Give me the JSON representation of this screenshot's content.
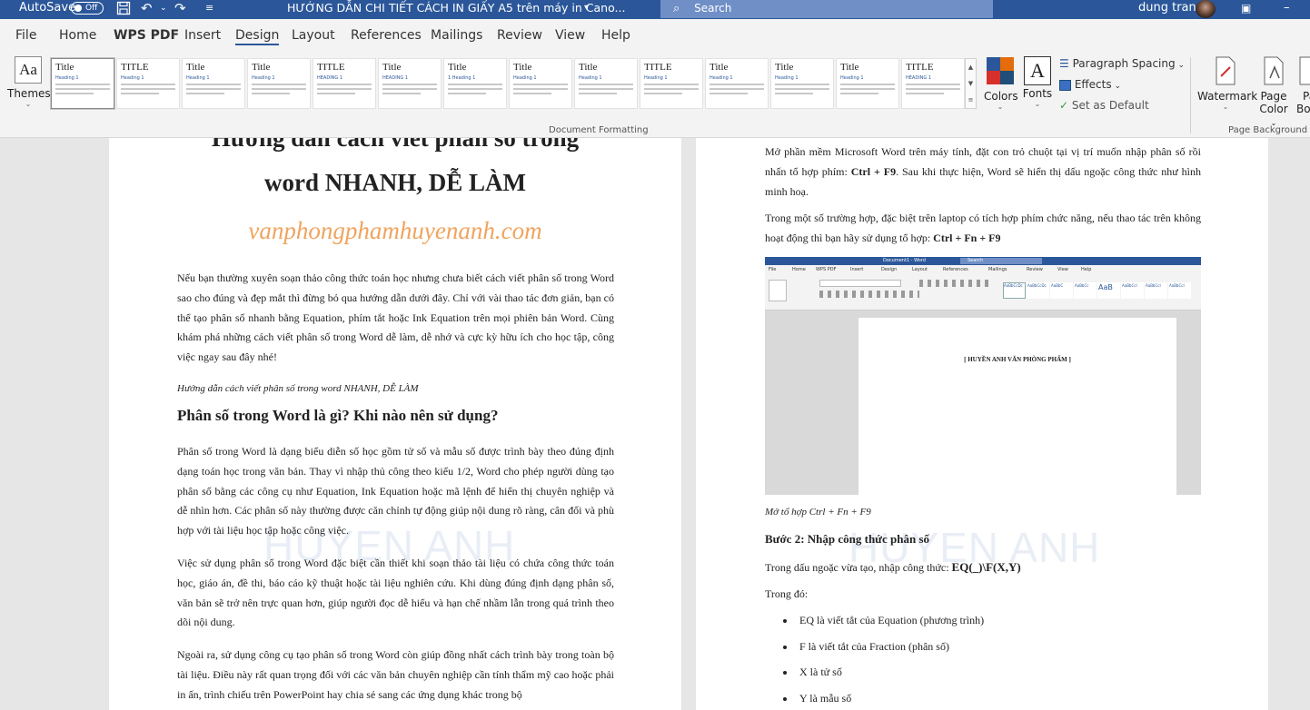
{
  "titlebar": {
    "autosave": "AutoSave",
    "autosave_state": "Off",
    "doc_title": "HƯỚNG DẪN CHI TIẾT CÁCH IN GIẤY A5 trên máy in Cano...",
    "search_placeholder": "Search",
    "user": "dung tran"
  },
  "menu": {
    "tabs": [
      "File",
      "Home",
      "WPS PDF",
      "Insert",
      "Design",
      "Layout",
      "References",
      "Mailings",
      "Review",
      "View",
      "Help"
    ],
    "active": "Design"
  },
  "ribbon": {
    "themes_label": "Themes",
    "themes_icon_text": "Aa",
    "styles": [
      {
        "title": "Title",
        "heading": "Heading 1"
      },
      {
        "title": "TITLE",
        "heading": "Heading 1"
      },
      {
        "title": "Title",
        "heading": "Heading 1"
      },
      {
        "title": "Title",
        "heading": "Heading 1"
      },
      {
        "title": "TITLE",
        "heading": "HEADING 1"
      },
      {
        "title": "Title",
        "heading": "HEADING 1"
      },
      {
        "title": "Title",
        "heading": "1 Heading 1"
      },
      {
        "title": "Title",
        "heading": "Heading 1"
      },
      {
        "title": "Title",
        "heading": "Heading 1"
      },
      {
        "title": "TITLE",
        "heading": "Heading 1"
      },
      {
        "title": "Title",
        "heading": "Heading 1"
      },
      {
        "title": "Title",
        "heading": "Heading 1"
      },
      {
        "title": "Title",
        "heading": "Heading 1"
      },
      {
        "title": "TITLE",
        "heading": "HEADING 1"
      }
    ],
    "group_document_formatting": "Document Formatting",
    "colors_label": "Colors",
    "fonts_label": "Fonts",
    "fonts_icon_text": "A",
    "paragraph_spacing": "Paragraph Spacing",
    "effects": "Effects",
    "set_default": "Set as Default",
    "watermark": "Watermark",
    "page_color_1": "Page",
    "page_color_2": "Color",
    "page_borders_1": "Pa",
    "page_borders_2": "Bo",
    "group_page_background": "Page Background"
  },
  "page1": {
    "title_line1": "Hướng dẫn cách viết phân số trong",
    "title_line2": "word NHANH, DỄ LÀM",
    "site": "vanphongphamhuyenanh.com",
    "p1": "Nếu bạn thường xuyên soạn thảo công thức toán học nhưng chưa biết cách viết phân số trong Word sao cho đúng và đẹp mắt thì đừng bỏ qua hướng dẫn dưới đây. Chỉ với vài thao tác đơn giản, bạn có thể tạo phân số nhanh bằng Equation, phím tắt hoặc Ink Equation trên mọi phiên bản Word. Cùng khám phá những cách viết phân số trong Word dễ làm, dễ nhớ và cực kỳ hữu ích cho học tập, công việc ngay sau đây nhé!",
    "caption": "Hướng dẫn cách viết phân số trong word NHANH, DỄ LÀM",
    "heading": "Phân số trong Word là gì? Khi nào nên sử dụng?",
    "p2": "Phân số trong Word là dạng biểu diễn số học gồm tử số và mẫu số được trình bày theo đúng định dạng toán học trong văn bản. Thay vì nhập thủ công theo kiểu 1/2, Word cho phép người dùng tạo phân số bằng các công cụ như Equation, Ink Equation hoặc mã lệnh để hiển thị chuyên nghiệp và dễ nhìn hơn. Các phân số này thường được căn chỉnh tự động giúp nội dung rõ ràng, cân đối và phù hợp với tài liệu học tập hoặc công việc.",
    "p3": "Việc sử dụng phân số trong Word đặc biệt cần thiết khi soạn thảo tài liệu có chứa công thức toán học, giáo án, đề thi, báo cáo kỹ thuật hoặc tài liệu nghiên cứu. Khi dùng đúng định dạng phân số, văn bản sẽ trở nên trực quan hơn, giúp người đọc dễ hiểu và hạn chế nhầm lẫn trong quá trình theo dõi nội dung.",
    "p4": "Ngoài ra, sử dụng công cụ tạo phân số trong Word còn giúp đồng nhất cách trình bày trong toàn bộ tài liệu. Điều này rất quan trọng đối với các văn bản chuyên nghiệp cần tính thẩm mỹ cao hoặc phải in ấn, trình chiếu trên PowerPoint hay chia sẻ sang các ứng dụng khác trong bộ",
    "watermark": "HUYEN ANH"
  },
  "page2": {
    "p1": "Mở phần mềm Microsoft Word trên máy tính, đặt con trỏ chuột tại vị trí muốn nhập phân số rồi nhấn tổ hợp phím: ",
    "p1_bold": "Ctrl + F9",
    "p1_tail": ". Sau khi thực hiện, Word sẽ hiển thị dấu ngoặc công thức như hình minh hoạ.",
    "p2": "Trong một số trường hợp, đặc biệt trên laptop có tích hợp phím chức năng, nếu thao tác trên không hoạt động thì bạn hãy sử dụng tổ hợp: ",
    "p2_bold": "Ctrl + Fn + F9",
    "shot_text": "[ HUYỀN ANH VĂN PHÒNG PHẨM ]",
    "shot_titlebar": "Document1 - Word",
    "shot_search": "Search",
    "shot_tabs": [
      "File",
      "Home",
      "WPS PDF",
      "Insert",
      "Design",
      "Layout",
      "References",
      "Mailings",
      "Review",
      "View",
      "Help"
    ],
    "shot_styles": [
      "AaBbCcDc",
      "AaBbCcDc",
      "AaBbC",
      "AaBbCc",
      "AaB",
      "AaBbCcI",
      "AaBbCcI",
      "AaBbCcI"
    ],
    "caption": "Mở tổ hợp Ctrl + Fn + F9",
    "step": "Bước 2: Nhập công thức phân số",
    "p3": "Trong dấu ngoặc vừa tạo, nhập công thức: ",
    "p3_bold": "EQ(_)\\F(X,Y)",
    "p4": "Trong đó:",
    "bullets": [
      "EQ là viết tắt của Equation (phương trình)",
      "F là viết tắt của Fraction (phân số)",
      "X là tử số",
      "Y là mẫu số"
    ],
    "watermark": "HUYEN ANH"
  }
}
